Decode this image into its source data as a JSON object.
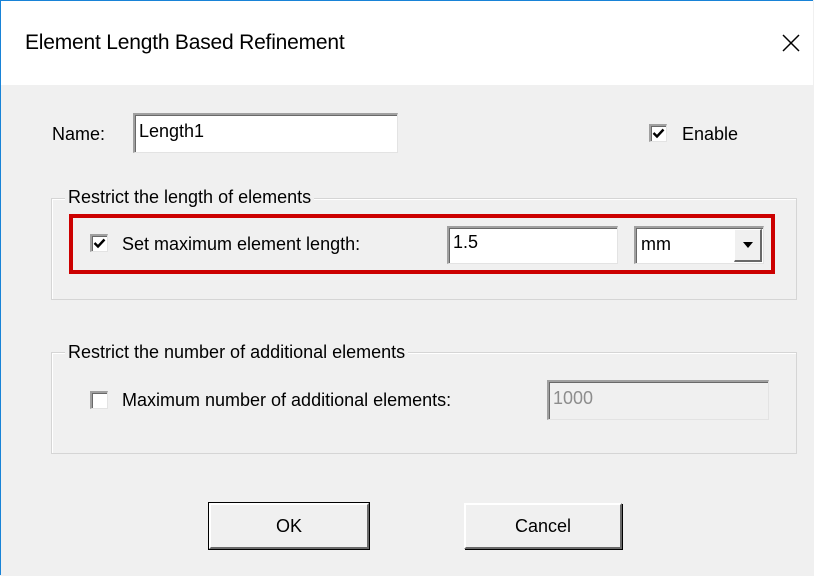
{
  "window": {
    "title": "Element Length Based Refinement",
    "close_glyph": "✕"
  },
  "name_row": {
    "label": "Name:",
    "value": "Length1",
    "enable_label": "Enable",
    "enable_checked": true
  },
  "group_length": {
    "legend": "Restrict the length of elements",
    "checkbox_label": "Set maximum element length:",
    "checked": true,
    "value": "1.5",
    "unit": "mm",
    "highlight_color": "#cc0000"
  },
  "group_count": {
    "legend": "Restrict the number of additional elements",
    "checkbox_label": "Maximum number of additional elements:",
    "checked": false,
    "value": "1000",
    "disabled": true
  },
  "buttons": {
    "ok": "OK",
    "cancel": "Cancel"
  },
  "icons": {
    "close": "close-icon",
    "check": "checkmark-icon",
    "dropdown": "chevron-down-icon"
  }
}
